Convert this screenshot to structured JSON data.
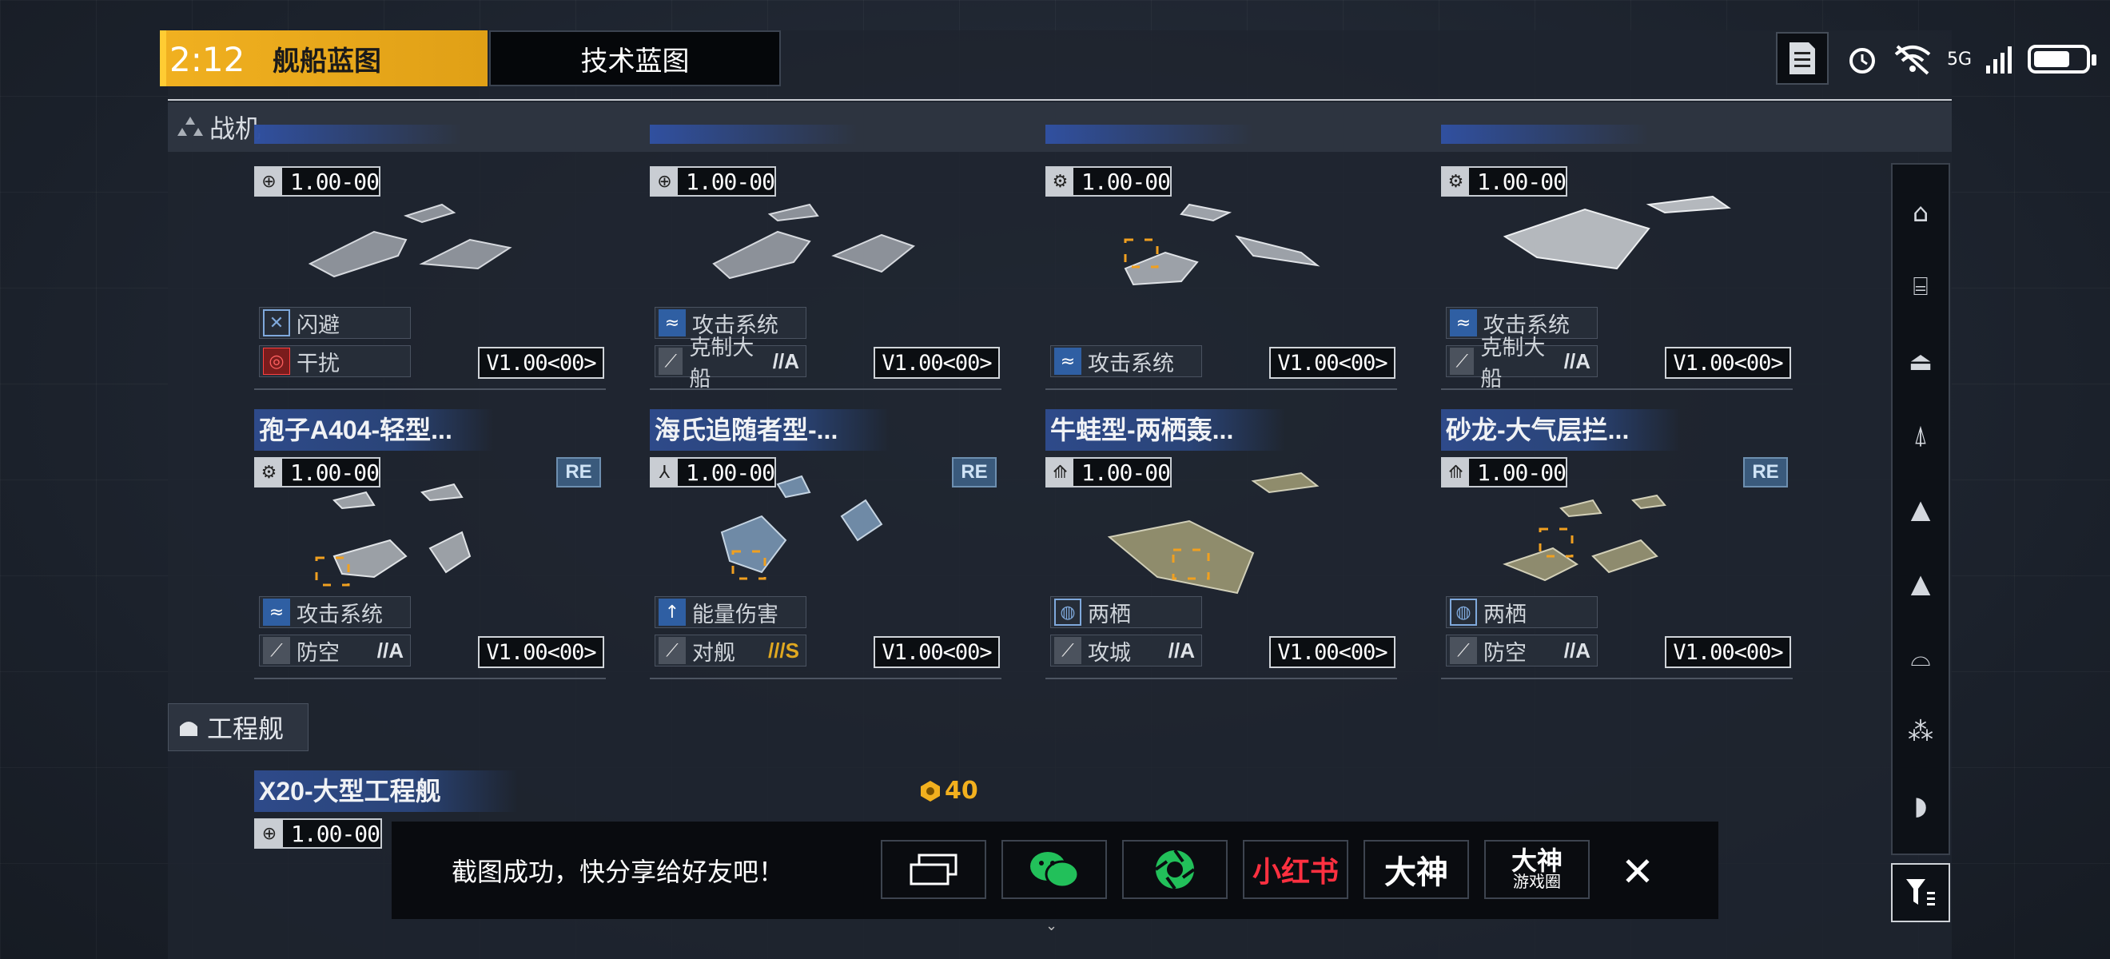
{
  "status_bar": {
    "time": "2:12",
    "network": "5G"
  },
  "tabs": [
    {
      "label": "舰船蓝图",
      "active": true
    },
    {
      "label": "技术蓝图",
      "active": false
    }
  ],
  "sections": {
    "fighter": "战机",
    "engineering": "工程舰"
  },
  "cards_row1": [
    {
      "value": "1.00",
      "suffix": "-00",
      "trait1": "闪避",
      "trait2": "干扰",
      "rank": "",
      "version": "V1.00<00>"
    },
    {
      "value": "1.00",
      "suffix": "-00",
      "trait1": "攻击系统",
      "trait2": "克制大船",
      "rank": "//A",
      "version": "V1.00<00>"
    },
    {
      "value": "1.00",
      "suffix": "-00",
      "trait1": "",
      "trait2": "攻击系统",
      "rank": "",
      "version": "V1.00<00>"
    },
    {
      "value": "1.00",
      "suffix": "-00",
      "trait1": "攻击系统",
      "trait2": "克制大船",
      "rank": "//A",
      "version": "V1.00<00>"
    }
  ],
  "cards_row2": [
    {
      "title": "孢子A404-轻型...",
      "value": "1.00",
      "suffix": "-00",
      "badge": "RE",
      "trait1": "攻击系统",
      "trait2": "防空",
      "rank": "//A",
      "version": "V1.00<00>"
    },
    {
      "title": "海氏追随者型-...",
      "value": "1.00",
      "suffix": "-00",
      "badge": "RE",
      "trait1": "能量伤害",
      "trait2": "对舰",
      "rank": "///S",
      "version": "V1.00<00>"
    },
    {
      "title": "牛蛙型-两栖轰...",
      "value": "1.00",
      "suffix": "-00",
      "badge": "",
      "trait1": "两栖",
      "trait2": "攻城",
      "rank": "//A",
      "version": "V1.00<00>"
    },
    {
      "title": "砂龙-大气层拦...",
      "value": "1.00",
      "suffix": "-00",
      "badge": "RE",
      "trait1": "两栖",
      "trait2": "防空",
      "rank": "//A",
      "version": "V1.00<00>"
    }
  ],
  "engineering_card": {
    "title": "X20-大型工程舰",
    "value": "1.00",
    "suffix": "-00"
  },
  "currency": {
    "amount": "40"
  },
  "share_bar": {
    "message": "截图成功，快分享给好友吧！",
    "targets": [
      "小红书",
      "大神",
      "大神",
      "游戏圈"
    ]
  },
  "colors": {
    "accent": "#f0b020",
    "title_blue": "#2e4a8a",
    "re_badge": "#3a5a7c",
    "wechat": "#22c05a",
    "xiaohongshu": "#e02232"
  }
}
